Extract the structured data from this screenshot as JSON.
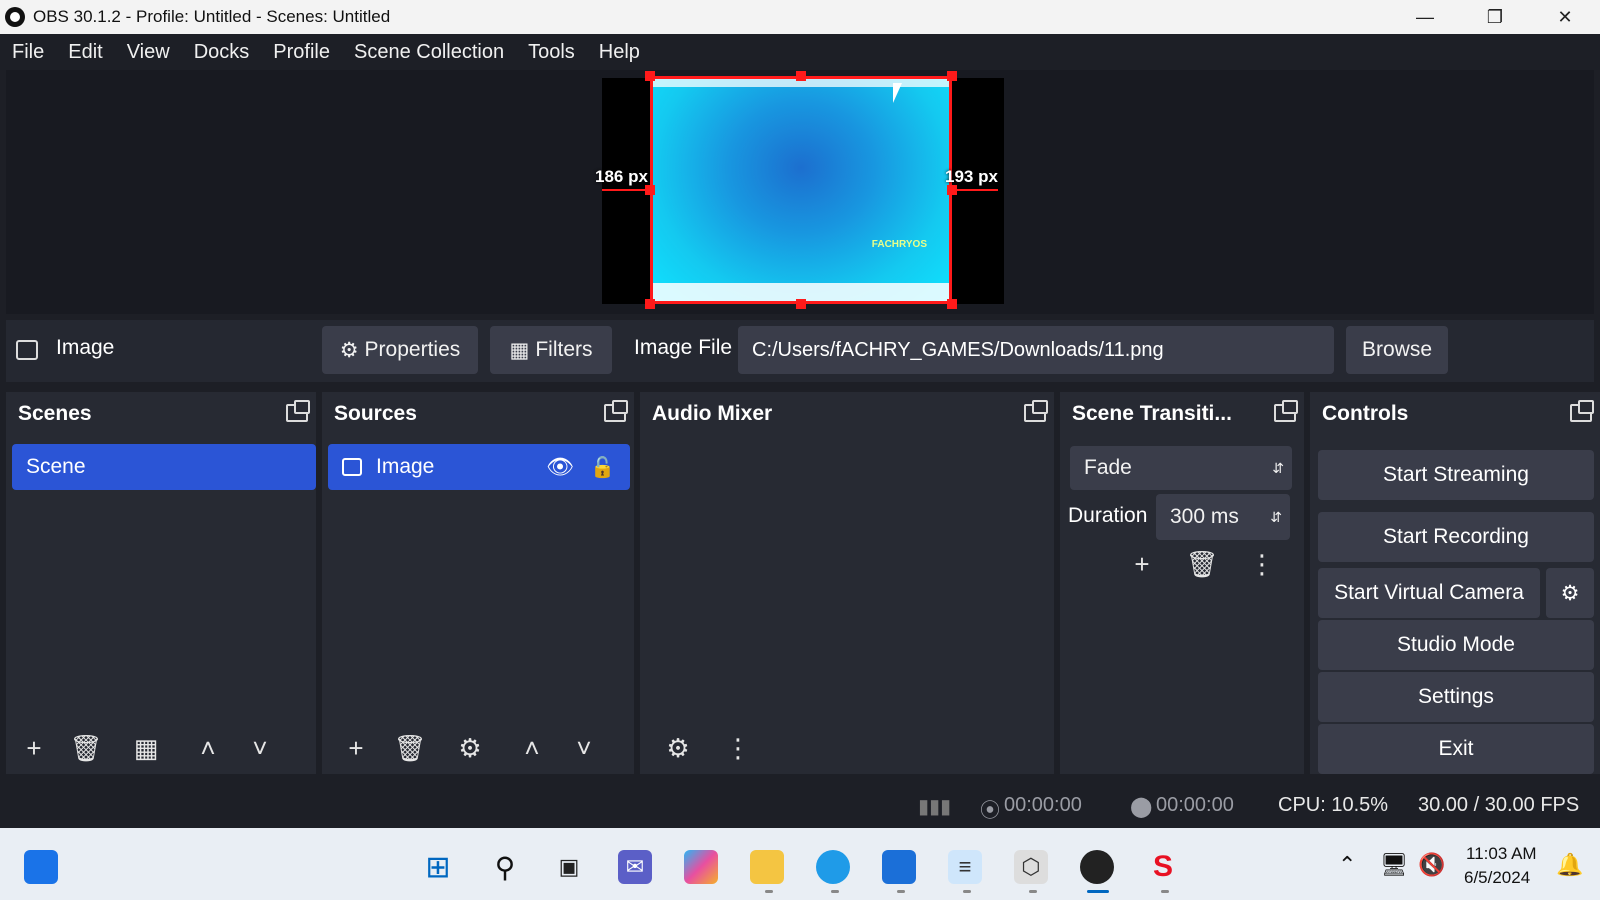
{
  "window": {
    "title": "OBS 30.1.2 - Profile: Untitled - Scenes: Untitled",
    "minimize": "—",
    "maximize": "❐",
    "close": "✕"
  },
  "menu": [
    "File",
    "Edit",
    "View",
    "Docks",
    "Profile",
    "Scene Collection",
    "Tools",
    "Help"
  ],
  "preview": {
    "left_distance": "186 px",
    "right_distance": "193 px",
    "brand_text": "FACHRYOS"
  },
  "context": {
    "source_name": "Image",
    "properties_label": "Properties",
    "filters_label": "Filters",
    "image_file_label": "Image File",
    "image_file_value": "C:/Users/fACHRY_GAMES/Downloads/11.png",
    "browse_label": "Browse"
  },
  "scenes": {
    "title": "Scenes",
    "items": [
      "Scene"
    ]
  },
  "sources": {
    "title": "Sources",
    "items": [
      "Image"
    ]
  },
  "audio_mixer": {
    "title": "Audio Mixer"
  },
  "transitions": {
    "title": "Scene Transiti...",
    "selected": "Fade",
    "duration_label": "Duration",
    "duration_value": "300 ms"
  },
  "controls": {
    "title": "Controls",
    "start_streaming": "Start Streaming",
    "start_recording": "Start Recording",
    "start_virtual_camera": "Start Virtual Camera",
    "studio_mode": "Studio Mode",
    "settings": "Settings",
    "exit": "Exit"
  },
  "status": {
    "stream_time": "00:00:00",
    "record_time": "00:00:00",
    "cpu": "CPU: 10.5%",
    "fps": "30.00 / 30.00 FPS"
  },
  "taskbar": {
    "time": "11:03 AM",
    "date": "6/5/2024"
  },
  "colors": {
    "accent": "#2b55d6",
    "selection_border": "#ff1a1a",
    "dock_bg": "#272a33",
    "window_bg": "#1d1f26"
  }
}
